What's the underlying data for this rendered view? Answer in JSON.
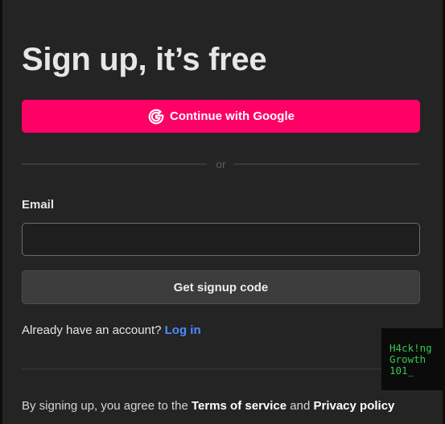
{
  "title": "Sign up, it’s free",
  "google_button": {
    "label": "Continue with Google",
    "icon": "google-g-icon",
    "color": "#ff0066"
  },
  "divider_text": "or",
  "email": {
    "label": "Email",
    "value": "",
    "placeholder": ""
  },
  "signup_button": {
    "label": "Get signup code"
  },
  "login": {
    "prompt": "Already have an account?",
    "link": "Log in",
    "link_color": "#4a8cff"
  },
  "terms": {
    "prefix": "By signing up, you agree to the",
    "terms_link": "Terms of service",
    "conjunction": "and",
    "privacy_link": "Privacy policy"
  },
  "watermark": {
    "line1": "H4ck!ng",
    "line2": "Growth",
    "line3": "101_",
    "color": "#39c64a"
  }
}
